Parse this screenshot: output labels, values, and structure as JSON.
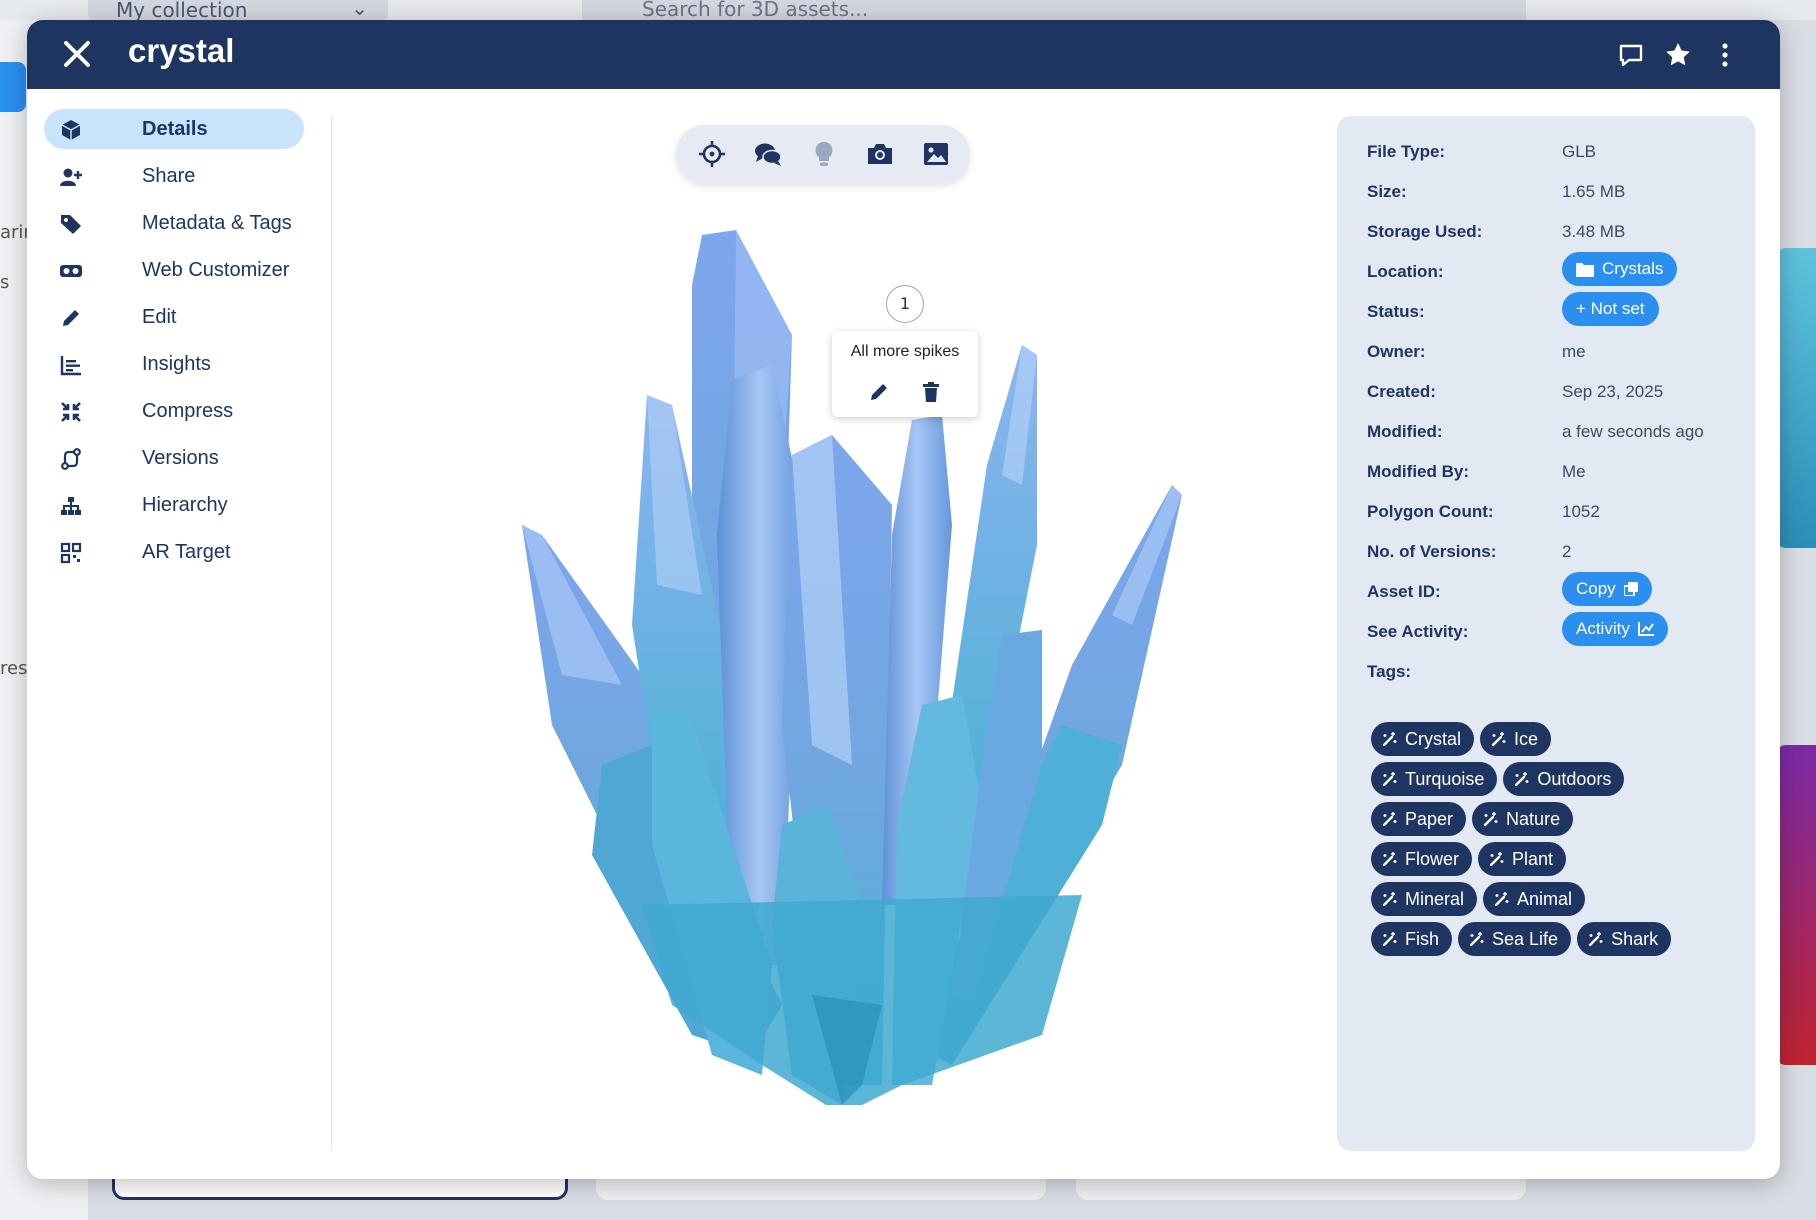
{
  "background": {
    "collection_label": "My collection",
    "search_placeholder": "Search for 3D assets...",
    "side_fragments": [
      "arin",
      "s",
      "res"
    ]
  },
  "modal": {
    "title": "crystal",
    "header_icons": [
      "comment-icon",
      "star-icon",
      "more-vertical-icon"
    ]
  },
  "nav": {
    "items": [
      {
        "label": "Details",
        "icon": "cube-icon",
        "active": true
      },
      {
        "label": "Share",
        "icon": "user-plus-icon"
      },
      {
        "label": "Metadata & Tags",
        "icon": "tag-icon"
      },
      {
        "label": "Web Customizer",
        "icon": "vr-goggles-icon"
      },
      {
        "label": "Edit",
        "icon": "pencil-icon"
      },
      {
        "label": "Insights",
        "icon": "bar-chart-icon"
      },
      {
        "label": "Compress",
        "icon": "compress-icon"
      },
      {
        "label": "Versions",
        "icon": "versions-icon"
      },
      {
        "label": "Hierarchy",
        "icon": "hierarchy-icon"
      },
      {
        "label": "AR Target",
        "icon": "qr-code-icon"
      }
    ]
  },
  "viewer": {
    "toolbar": [
      "crosshair-icon",
      "comments-icon",
      "lightbulb-icon",
      "camera-icon",
      "image-icon"
    ],
    "hotspot_number": "1",
    "annotation_text": "All more spikes"
  },
  "details": {
    "file_type": {
      "label": "File Type:",
      "value": "GLB"
    },
    "size": {
      "label": "Size:",
      "value": "1.65 MB"
    },
    "storage": {
      "label": "Storage Used:",
      "value": "3.48 MB"
    },
    "location": {
      "label": "Location:",
      "value": "Crystals"
    },
    "status": {
      "label": "Status:",
      "value": "+ Not set"
    },
    "owner": {
      "label": "Owner:",
      "value": "me"
    },
    "created": {
      "label": "Created:",
      "value": "Sep 23, 2025"
    },
    "modified": {
      "label": "Modified:",
      "value": "a few seconds ago"
    },
    "modified_by": {
      "label": "Modified By:",
      "value": "Me"
    },
    "polygons": {
      "label": "Polygon Count:",
      "value": "1052"
    },
    "versions": {
      "label": "No. of Versions:",
      "value": "2"
    },
    "asset_id": {
      "label": "Asset ID:",
      "value": "Copy"
    },
    "activity": {
      "label": "See Activity:",
      "value": "Activity"
    },
    "tags_label": "Tags:"
  },
  "tags": [
    [
      "Crystal",
      "Ice"
    ],
    [
      "Turquoise",
      "Outdoors"
    ],
    [
      "Paper",
      "Nature"
    ],
    [
      "Flower",
      "Plant"
    ],
    [
      "Mineral",
      "Animal"
    ],
    [
      "Fish",
      "Sea Life",
      "Shark"
    ]
  ],
  "colors": {
    "header": "#1e3461",
    "accent": "#2b8ff0",
    "panel": "#e3e9f2",
    "active_nav": "#c9e3fb"
  }
}
